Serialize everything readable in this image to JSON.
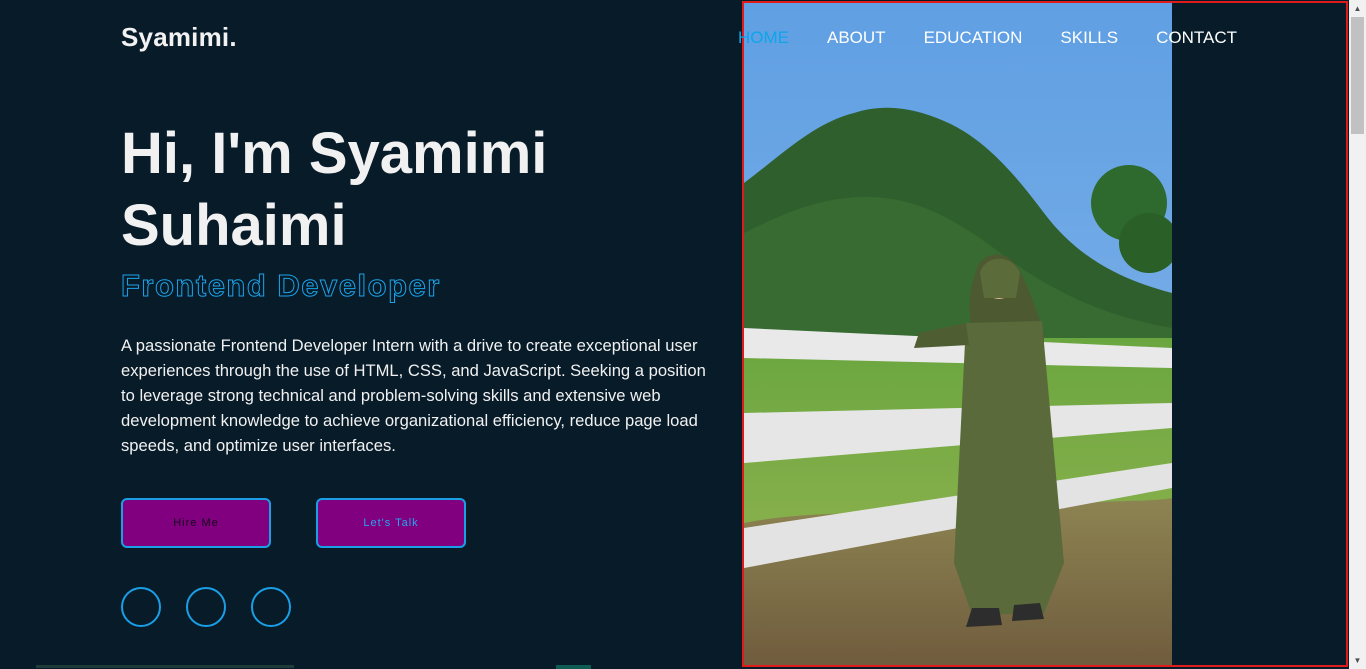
{
  "header": {
    "logo": "Syamimi.",
    "nav": [
      {
        "label": "HOME",
        "active": true
      },
      {
        "label": "ABOUT",
        "active": false
      },
      {
        "label": "EDUCATION",
        "active": false
      },
      {
        "label": "SKILLS",
        "active": false
      },
      {
        "label": "CONTACT",
        "active": false
      }
    ]
  },
  "hero": {
    "title": "Hi, I'm Syamimi Suhaimi",
    "role": "Frontend Developer",
    "description": "A passionate Frontend Developer Intern with a drive to create exceptional user experiences through the use of HTML, CSS, and JavaScript. Seeking a position to leverage strong technical and problem-solving skills and extensive web development knowledge to achieve organizational efficiency, reduce page load speeds, and optimize user interfaces.",
    "buttons": {
      "hire": "Hire Me",
      "talk": "Let's Talk"
    },
    "social_icons": [
      "social-link",
      "social-link",
      "social-link"
    ]
  },
  "colors": {
    "background": "#081b29",
    "accent": "#0ea5e9",
    "button_fill": "#800080",
    "frame_border": "#e01b1b"
  }
}
